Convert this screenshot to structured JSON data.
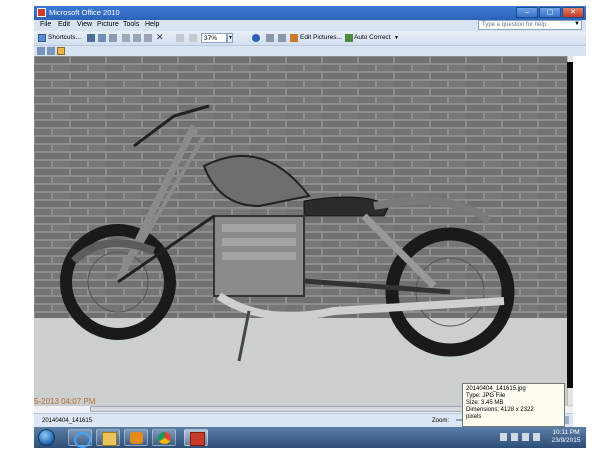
{
  "window": {
    "title": "Microsoft Office 2010",
    "controls": [
      "–",
      "▢",
      "✕"
    ]
  },
  "menu": {
    "items": [
      "File",
      "Edit",
      "View",
      "Picture",
      "Tools",
      "Help"
    ],
    "help_placeholder": "Type a question for help"
  },
  "toolbar": {
    "shortcuts_label": "Shortcuts...",
    "zoom_value": "37%",
    "edit_pictures_label": "Edit Pictures...",
    "auto_correct_label": "Auto Correct"
  },
  "image": {
    "timestamp_overlay": "5-2013 04:07 PM"
  },
  "tooltip": {
    "filename": "20140404_141615.jpg",
    "type": "Type: JPG File",
    "size": "Size: 3.45 MB",
    "dimensions": "Dimensions: 4128 x 2322",
    "pixels": "pixels"
  },
  "statusbar": {
    "filename": "20140404_141615",
    "zoom_label": "Zoom:"
  },
  "taskbar": {
    "apps": [
      "internet-explorer",
      "file-explorer",
      "media-player",
      "chrome",
      "office-picture-manager"
    ],
    "time": "10:11 PM",
    "date": "23/9/2015"
  },
  "colors": {
    "titlebar": "#2c63b8",
    "menubar": "#d9e4f3",
    "taskbar": "#2d4d75",
    "timestamp_overlay": "#b26a3b"
  }
}
